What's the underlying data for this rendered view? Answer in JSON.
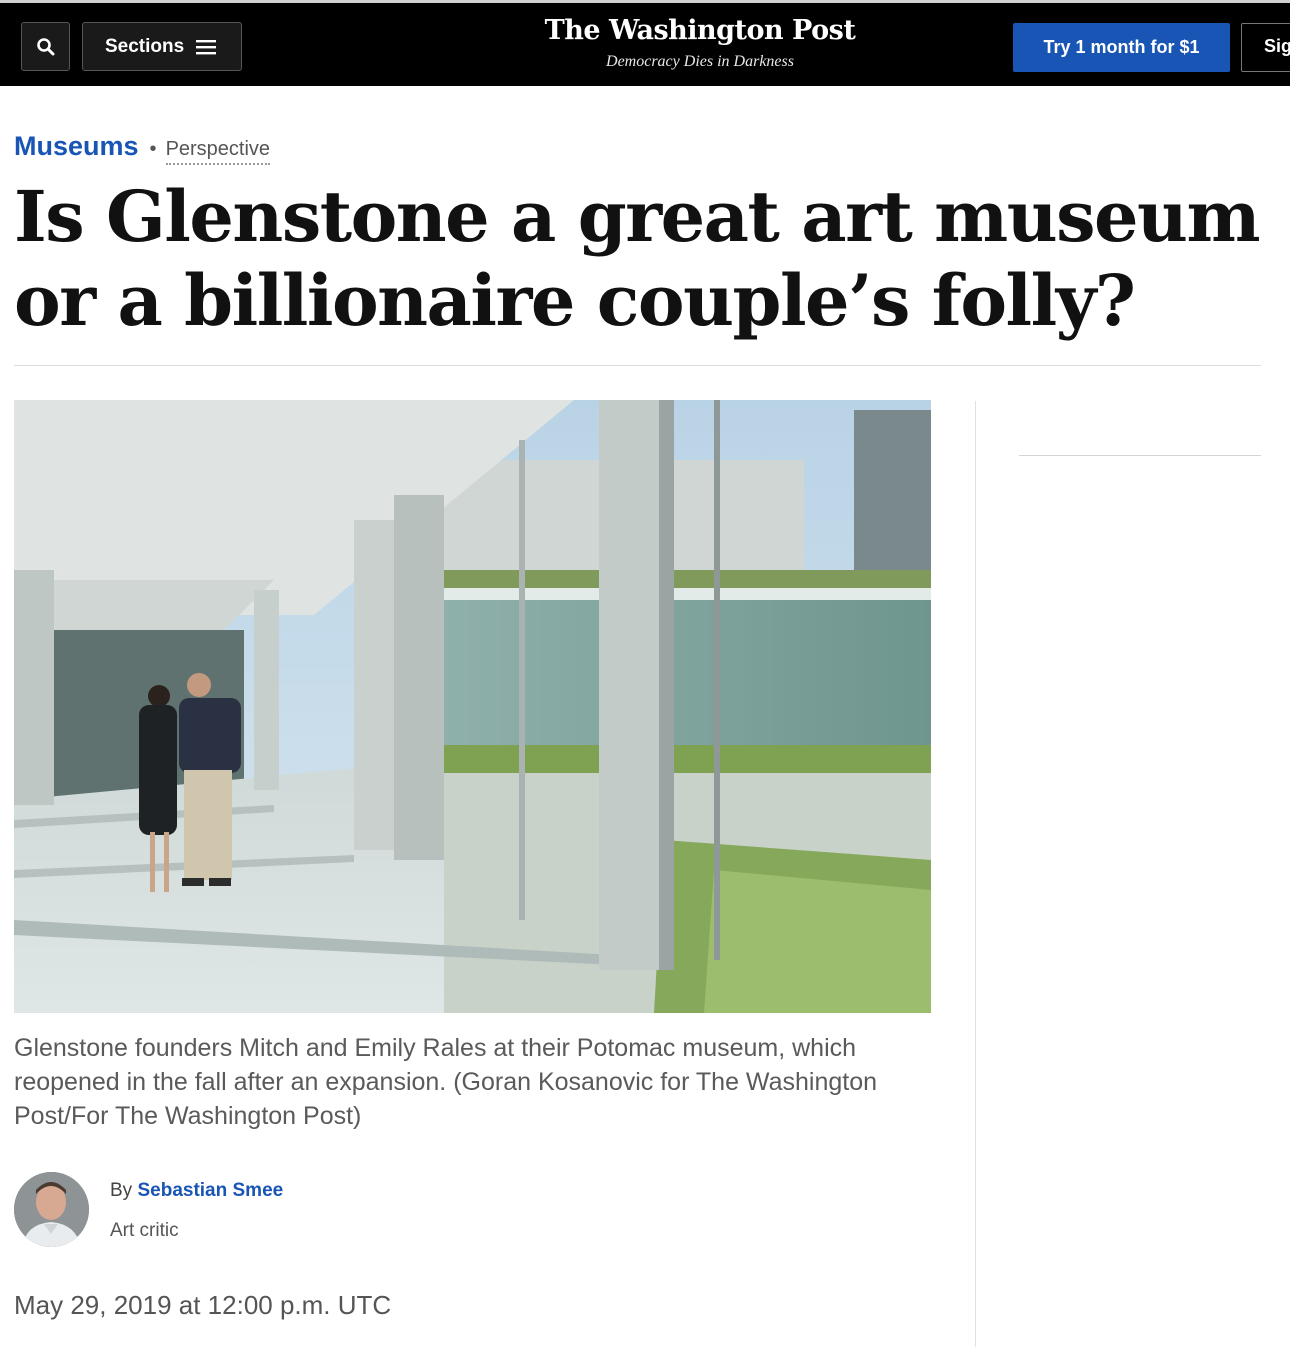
{
  "header": {
    "sections_label": "Sections",
    "masthead_name": "The Washington Post",
    "tagline": "Democracy Dies in Darkness",
    "cta_label": "Try 1 month for $1",
    "signin_label": "Sign in",
    "accent_color": "#1955b5",
    "icons": {
      "search": "search-icon",
      "menu": "hamburger-menu-icon"
    }
  },
  "article": {
    "section": "Museums",
    "label": "Perspective",
    "headline": "Is Glenstone a great art museum or a billionaire couple’s folly?",
    "photo_alt": "Glenstone founders Mitch and Emily Rales at their Potomac museum",
    "caption": "Glenstone founders Mitch and Emily Rales at their Potomac museum, which reopened in the fall after an expansion. (Goran Kosanovic for The Washington Post/For The Washington Post)",
    "byline_prefix": "By",
    "author": "Sebastian Smee",
    "author_role": "Art critic",
    "date": "May 29, 2019 at 12:00 p.m. UTC"
  }
}
